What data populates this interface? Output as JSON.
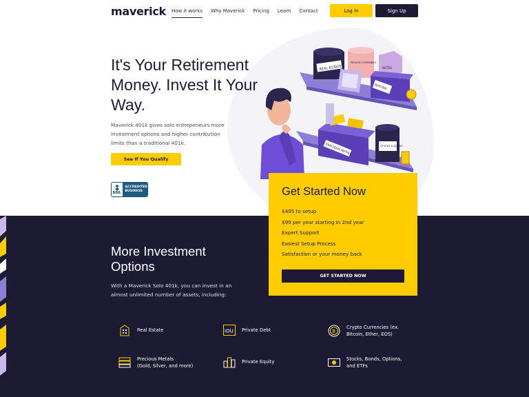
{
  "header": {
    "logo": "maverick",
    "nav": [
      "How it works",
      "Why Maverick",
      "Pricing",
      "Learn",
      "Contact"
    ],
    "login_label": "Log In",
    "signup_label": "Sign Up"
  },
  "hero": {
    "title": "It's Your Retirement Money. Invest It Your Way.",
    "description": "Maverick 401k gives solo entrepeneurs more investment options and higher contribution limits than a traditional 401k.",
    "cta_label": "See If You Qualify",
    "bbb": {
      "mark": "BBB.",
      "text_line1": "ACCREDITED",
      "text_line2": "BUSINESS"
    }
  },
  "illustration": {
    "labels": [
      "REAL ESTATE",
      "PRIVATE COMPANIES",
      "NOTES",
      "BITCOIN",
      "PRECIOUS METALS",
      "STOCKS & BONDS"
    ]
  },
  "card": {
    "title": "Get Started Now",
    "items": [
      "$495 to setup",
      "$99 per year starting in 2nd year",
      "Expert Support",
      "Easiest Setup Process",
      "Satisfaction or your money back"
    ],
    "cta_label": "GET STARTED NOW"
  },
  "investments": {
    "title": "More Investment Options",
    "description": "With a Maverick Solo 401k, you can invest in an almost unlimited number of assets, including:",
    "assets": [
      {
        "line1": "Real Estate",
        "line2": "",
        "icon": "building-icon"
      },
      {
        "line1": "Private Debt",
        "line2": "",
        "icon": "iou-icon"
      },
      {
        "line1": "Crypto Currencies (ex.",
        "line2": "Bitcoin, Ether, EOS)",
        "icon": "bitcoin-icon"
      },
      {
        "line1": "Precious Metals",
        "line2": "(Gold, Silver, and more)",
        "icon": "gold-bars-icon"
      },
      {
        "line1": "Private Equity",
        "line2": "",
        "icon": "city-icon"
      },
      {
        "line1": "Stocks, Bonds, Options,",
        "line2": "and ETFs",
        "icon": "stocks-certificate-icon"
      }
    ]
  },
  "colors": {
    "accent": "#ffcc00",
    "dark": "#1d1a33",
    "purple": "#6c4fd6"
  }
}
